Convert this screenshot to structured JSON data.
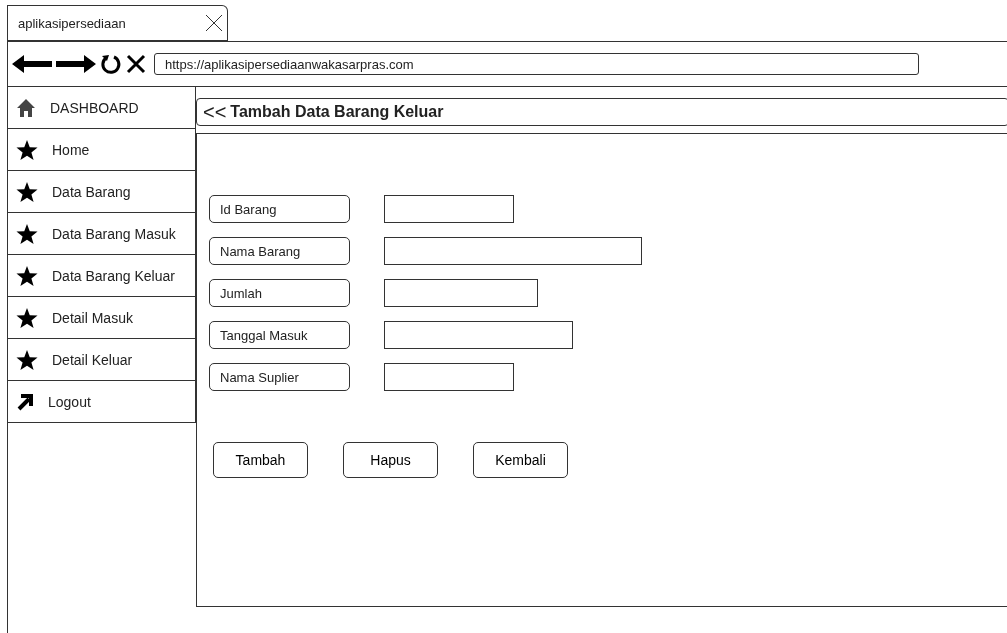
{
  "browser": {
    "tab_title": "aplikasipersediaan",
    "url": "https://aplikasipersediaanwakasarpras.com"
  },
  "sidebar": {
    "items": [
      {
        "label": "DASHBOARD",
        "kind": "home"
      },
      {
        "label": "Home",
        "kind": "star"
      },
      {
        "label": "Data Barang",
        "kind": "star"
      },
      {
        "label": "Data Barang Masuk",
        "kind": "star"
      },
      {
        "label": "Data Barang Keluar",
        "kind": "star"
      },
      {
        "label": "Detail Masuk",
        "kind": "star"
      },
      {
        "label": "Detail Keluar",
        "kind": "star"
      },
      {
        "label": "Logout",
        "kind": "logout"
      }
    ]
  },
  "page": {
    "back": "<<",
    "title": "Tambah Data Barang Keluar"
  },
  "form": {
    "fields": [
      {
        "label": "Id Barang"
      },
      {
        "label": "Nama Barang"
      },
      {
        "label": "Jumlah"
      },
      {
        "label": "Tanggal Masuk"
      },
      {
        "label": "Nama Suplier"
      }
    ],
    "buttons": [
      "Tambah",
      "Hapus",
      "Kembali"
    ]
  }
}
